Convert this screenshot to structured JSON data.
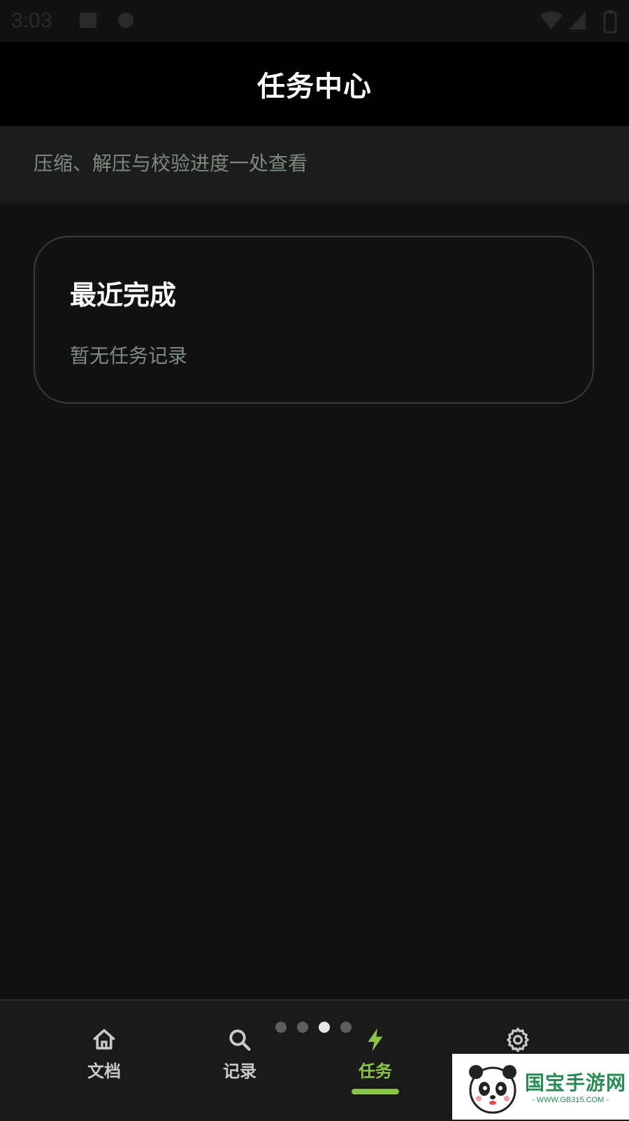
{
  "status_bar": {
    "time": "3:03"
  },
  "app_bar": {
    "title": "任务中心"
  },
  "subtitle": "压缩、解压与校验进度一处查看",
  "card": {
    "title": "最近完成",
    "empty_text": "暂无任务记录"
  },
  "bottom_nav": {
    "page_index": 3,
    "page_count": 4,
    "items": [
      {
        "label": "文档",
        "icon": "home-icon"
      },
      {
        "label": "记录",
        "icon": "search-icon"
      },
      {
        "label": "任务",
        "icon": "lightning-icon",
        "active": true
      },
      {
        "label": "",
        "icon": "gear-icon"
      }
    ]
  },
  "watermark": {
    "brand": "国宝手游网",
    "url": "- WWW.GB315.COM -"
  },
  "colors": {
    "background": "#121212",
    "app_bar": "#000000",
    "accent": "#8bc34a",
    "muted_text": "#7d8a80"
  }
}
